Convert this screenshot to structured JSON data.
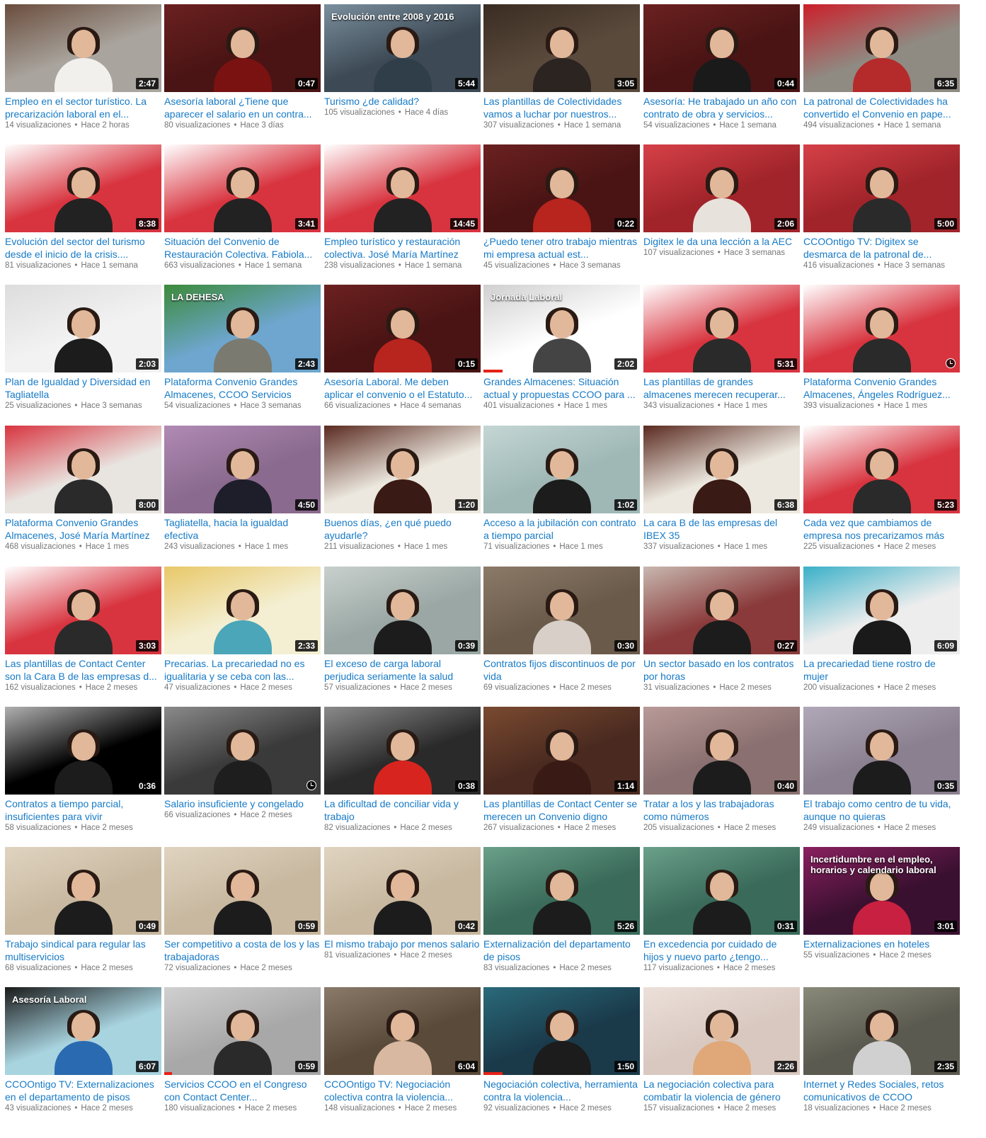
{
  "videos": [
    {
      "title": "Empleo en el sector turístico. La precarización laboral en el...",
      "views": "14 visualizaciones",
      "age": "Hace 2 horas",
      "duration": "2:47",
      "thumb": {
        "bg": "#a9a49d",
        "accent": "#6a4d3d",
        "person": "#f2f0ec"
      }
    },
    {
      "title": "Asesoría laboral ¿Tiene que aparecer el salario en un contra...",
      "views": "80 visualizaciones",
      "age": "Hace 3 días",
      "duration": "0:47",
      "thumb": {
        "bg": "#4a1414",
        "accent": "#6b2020",
        "person": "#7a1212"
      }
    },
    {
      "title": "Turismo ¿de calidad?",
      "views": "105 visualizaciones",
      "age": "Hace 4 días",
      "duration": "5:44",
      "thumb": {
        "bg": "#3d4a55",
        "accent": "#7b8f9e",
        "person": "#2f3e49",
        "overlay": "Evolución entre 2008 y 2016"
      }
    },
    {
      "title": "Las plantillas de Colectividades vamos a luchar por nuestros...",
      "views": "307 visualizaciones",
      "age": "Hace 1 semana",
      "duration": "3:05",
      "thumb": {
        "bg": "#5a4a3c",
        "accent": "#3a2c22",
        "person": "#2b2420"
      }
    },
    {
      "title": "Asesoría: He trabajado un año con contrato de obra y servicios...",
      "views": "54 visualizaciones",
      "age": "Hace 1 semana",
      "duration": "0:44",
      "thumb": {
        "bg": "#4a1414",
        "accent": "#6b2020",
        "person": "#1a1a1a"
      }
    },
    {
      "title": "La patronal de Colectividades ha convertido el Convenio en pape...",
      "views": "494 visualizaciones",
      "age": "Hace 1 semana",
      "duration": "6:35",
      "thumb": {
        "bg": "#8f8a82",
        "accent": "#cc1f2a",
        "person": "#b52a2a"
      }
    },
    {
      "title": "Evolución del sector del turismo desde el inicio de la crisis....",
      "views": "81 visualizaciones",
      "age": "Hace 1 semana",
      "duration": "8:38",
      "thumb": {
        "bg": "#d8343f",
        "accent": "#ffffff",
        "person": "#222222"
      }
    },
    {
      "title": "Situación del Convenio de Restauración Colectiva. Fabiola...",
      "views": "663 visualizaciones",
      "age": "Hace 1 semana",
      "duration": "3:41",
      "thumb": {
        "bg": "#d8343f",
        "accent": "#ffffff",
        "person": "#222222"
      }
    },
    {
      "title": "Empleo turístico y restauración colectiva. José María Martínez",
      "views": "238 visualizaciones",
      "age": "Hace 1 semana",
      "duration": "14:45",
      "thumb": {
        "bg": "#d8343f",
        "accent": "#ffffff",
        "person": "#222222"
      }
    },
    {
      "title": "¿Puedo tener otro trabajo mientras mi empresa actual est...",
      "views": "45 visualizaciones",
      "age": "Hace 3 semanas",
      "duration": "0:22",
      "thumb": {
        "bg": "#4a1414",
        "accent": "#6b2020",
        "person": "#b8241e"
      }
    },
    {
      "title": "Digitex le da una lección a la AEC",
      "views": "107 visualizaciones",
      "age": "Hace 3 semanas",
      "duration": "2:06",
      "thumb": {
        "bg": "#a0242a",
        "accent": "#d64048",
        "person": "#e8e2dc"
      }
    },
    {
      "title": "CCOOntigo TV: Digitex se desmarca de la patronal de...",
      "views": "416 visualizaciones",
      "age": "Hace 3 semanas",
      "duration": "5:00",
      "thumb": {
        "bg": "#a0242a",
        "accent": "#d64048",
        "person": "#2a2a2a"
      }
    },
    {
      "title": "Plan de Igualdad y Diversidad en Tagliatella",
      "views": "25 visualizaciones",
      "age": "Hace 3 semanas",
      "duration": "2:03",
      "thumb": {
        "bg": "#f2f2f2",
        "accent": "#dddddd",
        "person": "#1c1c1c"
      }
    },
    {
      "title": "Plataforma Convenio Grandes Almacenes, CCOO Servicios",
      "views": "54 visualizaciones",
      "age": "Hace 3 semanas",
      "duration": "2:43",
      "thumb": {
        "bg": "#6ea6cf",
        "accent": "#3c8a3a",
        "person": "#7a7a70",
        "overlay": "LA DEHESA"
      }
    },
    {
      "title": "Asesoría Laboral. Me deben aplicar el convenio o el Estatuto...",
      "views": "66 visualizaciones",
      "age": "Hace 4 semanas",
      "duration": "0:15",
      "thumb": {
        "bg": "#4a1414",
        "accent": "#6b2020",
        "person": "#b8241e"
      }
    },
    {
      "title": "Grandes Almacenes: Situación actual y propuestas CCOO para ...",
      "views": "401 visualizaciones",
      "age": "Hace 1 mes",
      "duration": "2:02",
      "thumb": {
        "bg": "#ffffff",
        "accent": "#d0d0d0",
        "person": "#444444",
        "overlay": "Jornada Laboral"
      }
    },
    {
      "title": "Las plantillas de grandes almacenes merecen recuperar...",
      "views": "343 visualizaciones",
      "age": "Hace 1 mes",
      "duration": "5:31",
      "thumb": {
        "bg": "#d8343f",
        "accent": "#ffffff",
        "person": "#2a2a2a"
      }
    },
    {
      "title": "Plataforma Convenio Grandes Almacenes, Ángeles Rodríguez...",
      "views": "393 visualizaciones",
      "age": "Hace 1 mes",
      "duration": "",
      "thumb": {
        "bg": "#d8343f",
        "accent": "#ffffff",
        "person": "#2a2a2a"
      }
    },
    {
      "title": "Plataforma Convenio Grandes Almacenes, José María Martínez",
      "views": "468 visualizaciones",
      "age": "Hace 1 mes",
      "duration": "8:00",
      "thumb": {
        "bg": "#e8e4e0",
        "accent": "#d8343f",
        "person": "#2a2a2a"
      }
    },
    {
      "title": "Tagliatella, hacia la igualdad efectiva",
      "views": "243 visualizaciones",
      "age": "Hace 1 mes",
      "duration": "4:50",
      "thumb": {
        "bg": "#8a6a8e",
        "accent": "#b08ab4",
        "person": "#1e1e2a"
      }
    },
    {
      "title": "Buenos días, ¿en qué puedo ayudarle?",
      "views": "211 visualizaciones",
      "age": "Hace 1 mes",
      "duration": "1:20",
      "thumb": {
        "bg": "#ece8df",
        "accent": "#5a2a20",
        "person": "#3a1a14"
      }
    },
    {
      "title": "Acceso a la jubilación con contrato a tiempo parcial",
      "views": "71 visualizaciones",
      "age": "Hace 1 mes",
      "duration": "1:02",
      "thumb": {
        "bg": "#9fb8b6",
        "accent": "#c4d6d4",
        "person": "#1c1c1c"
      }
    },
    {
      "title": "La cara B de las empresas del IBEX 35",
      "views": "337 visualizaciones",
      "age": "Hace 1 mes",
      "duration": "6:38",
      "thumb": {
        "bg": "#ece8df",
        "accent": "#5a2a20",
        "person": "#3a1a14"
      }
    },
    {
      "title": "Cada vez que cambiamos de empresa nos precarizamos más",
      "views": "225 visualizaciones",
      "age": "Hace 2 meses",
      "duration": "5:23",
      "thumb": {
        "bg": "#d8343f",
        "accent": "#ffffff",
        "person": "#2a2a2a"
      }
    },
    {
      "title": "Las plantillas de Contact Center son la Cara B de las empresas d...",
      "views": "162 visualizaciones",
      "age": "Hace 2 meses",
      "duration": "3:03",
      "thumb": {
        "bg": "#d8343f",
        "accent": "#ffffff",
        "person": "#2a2a2a"
      }
    },
    {
      "title": "Precarias. La precariedad no es igualitaria y se ceba con las...",
      "views": "47 visualizaciones",
      "age": "Hace 2 meses",
      "duration": "2:33",
      "thumb": {
        "bg": "#f4efd2",
        "accent": "#e8c868",
        "person": "#4aa6b8"
      }
    },
    {
      "title": "El exceso de carga laboral perjudica seriamente la salud",
      "views": "57 visualizaciones",
      "age": "Hace 2 meses",
      "duration": "0:39",
      "thumb": {
        "bg": "#9aa7a4",
        "accent": "#c8d0cc",
        "person": "#1c1c1c"
      }
    },
    {
      "title": "Contratos fijos discontinuos de por vida",
      "views": "69 visualizaciones",
      "age": "Hace 2 meses",
      "duration": "0:30",
      "thumb": {
        "bg": "#6a5a4a",
        "accent": "#8c7a68",
        "person": "#d8d0c8"
      }
    },
    {
      "title": "Un sector basado en los contratos por horas",
      "views": "31 visualizaciones",
      "age": "Hace 2 meses",
      "duration": "0:27",
      "thumb": {
        "bg": "#8a3a3a",
        "accent": "#c8b8b0",
        "person": "#1c1c1c"
      }
    },
    {
      "title": "La precariedad tiene rostro de mujer",
      "views": "200 visualizaciones",
      "age": "Hace 2 meses",
      "duration": "6:09",
      "thumb": {
        "bg": "#ededed",
        "accent": "#3ab0c8",
        "person": "#1a1a1a"
      }
    },
    {
      "title": "Contratos a tiempo parcial, insuficientes para vivir",
      "views": "58 visualizaciones",
      "age": "Hace 2 meses",
      "duration": "0:36",
      "thumb": {
        "bg": "#000000",
        "accent": "#b0b0b0",
        "person": "#1c1c1c"
      }
    },
    {
      "title": "Salario insuficiente y congelado",
      "views": "66 visualizaciones",
      "age": "Hace 2 meses",
      "duration": "",
      "thumb": {
        "bg": "#3a3a3a",
        "accent": "#8a8a8a",
        "person": "#1e1e1e"
      }
    },
    {
      "title": "La dificultad de conciliar vida y trabajo",
      "views": "82 visualizaciones",
      "age": "Hace 2 meses",
      "duration": "0:38",
      "thumb": {
        "bg": "#2a2a2a",
        "accent": "#8a8a8a",
        "person": "#d8241e"
      }
    },
    {
      "title": "Las plantillas de Contact Center se merecen un Convenio digno",
      "views": "267 visualizaciones",
      "age": "Hace 2 meses",
      "duration": "1:14",
      "thumb": {
        "bg": "#4a2a20",
        "accent": "#7a4a30",
        "person": "#3a1a14"
      }
    },
    {
      "title": "Tratar a los y las trabajadoras como números",
      "views": "205 visualizaciones",
      "age": "Hace 2 meses",
      "duration": "0:40",
      "thumb": {
        "bg": "#8a7070",
        "accent": "#b89a98",
        "person": "#1c1c1c"
      }
    },
    {
      "title": "El trabajo como centro de tu vida, aunque no quieras",
      "views": "249 visualizaciones",
      "age": "Hace 2 meses",
      "duration": "0:35",
      "thumb": {
        "bg": "#8a8090",
        "accent": "#b0a8b8",
        "person": "#1c1c1c"
      }
    },
    {
      "title": "Trabajo sindical para regular las multiservicios",
      "views": "68 visualizaciones",
      "age": "Hace 2 meses",
      "duration": "0:49",
      "thumb": {
        "bg": "#c8b8a0",
        "accent": "#e0d4c0",
        "person": "#1c1c1c"
      }
    },
    {
      "title": "Ser competitivo a costa de los y las trabajadoras",
      "views": "72 visualizaciones",
      "age": "Hace 2 meses",
      "duration": "0:59",
      "thumb": {
        "bg": "#c8b8a0",
        "accent": "#e0d4c0",
        "person": "#1c1c1c"
      }
    },
    {
      "title": "El mismo trabajo por menos salario",
      "views": "81 visualizaciones",
      "age": "Hace 2 meses",
      "duration": "0:42",
      "thumb": {
        "bg": "#c8b8a0",
        "accent": "#e0d4c0",
        "person": "#1c1c1c"
      }
    },
    {
      "title": "Externalización del departamento de pisos",
      "views": "83 visualizaciones",
      "age": "Hace 2 meses",
      "duration": "5:26",
      "thumb": {
        "bg": "#3a6a5a",
        "accent": "#6aa08a",
        "person": "#1c1c1c"
      }
    },
    {
      "title": "En excedencia por cuidado de hijos y nuevo parto ¿tengo...",
      "views": "117 visualizaciones",
      "age": "Hace 2 meses",
      "duration": "0:31",
      "thumb": {
        "bg": "#3a6a5a",
        "accent": "#6aa08a",
        "person": "#1c1c1c"
      }
    },
    {
      "title": "Externalizaciones en hoteles",
      "views": "55 visualizaciones",
      "age": "Hace 2 meses",
      "duration": "3:01",
      "thumb": {
        "bg": "#3a1030",
        "accent": "#8a2060",
        "person": "#c82040",
        "overlay": "Incertidumbre en el empleo, horarios y calendario laboral"
      }
    },
    {
      "title": "CCOOntigo TV: Externalizaciones en el departamento de pisos",
      "views": "43 visualizaciones",
      "age": "Hace 2 meses",
      "duration": "6:07",
      "thumb": {
        "bg": "#a8d4e0",
        "accent": "#1a1a1a",
        "person": "#2a6ab0",
        "overlay": "Asesoría Laboral"
      }
    },
    {
      "title": "Servicios CCOO en el Congreso con Contact Center...",
      "views": "180 visualizaciones",
      "age": "Hace 2 meses",
      "duration": "0:59",
      "thumb": {
        "bg": "#a8a8a8",
        "accent": "#d0d0d0",
        "person": "#2a2a2a"
      }
    },
    {
      "title": "CCOOntigo TV: Negociación colectiva contra la violencia...",
      "views": "148 visualizaciones",
      "age": "Hace 2 meses",
      "duration": "6:04",
      "thumb": {
        "bg": "#5a4a3a",
        "accent": "#8a7a6a",
        "person": "#d8b8a0"
      }
    },
    {
      "title": "Negociación colectiva, herramienta contra la violencia...",
      "views": "92 visualizaciones",
      "age": "Hace 2 meses",
      "duration": "1:50",
      "thumb": {
        "bg": "#1a3a4a",
        "accent": "#2a6a7a",
        "person": "#1c1c1c"
      }
    },
    {
      "title": "La negociación colectiva para combatir la violencia de género",
      "views": "157 visualizaciones",
      "age": "Hace 2 meses",
      "duration": "2:26",
      "thumb": {
        "bg": "#d8c8c0",
        "accent": "#ece0da",
        "person": "#e0a878"
      }
    },
    {
      "title": "Internet y Redes Sociales, retos comunicativos de CCOO",
      "views": "18 visualizaciones",
      "age": "Hace 2 meses",
      "duration": "2:35",
      "thumb": {
        "bg": "#5a5a50",
        "accent": "#8a8a7a",
        "person": "#d0d0d0"
      }
    }
  ],
  "meta_separator": "•",
  "colors": {
    "title": "#167ac6",
    "meta": "#767676",
    "progress": "#e62117"
  }
}
